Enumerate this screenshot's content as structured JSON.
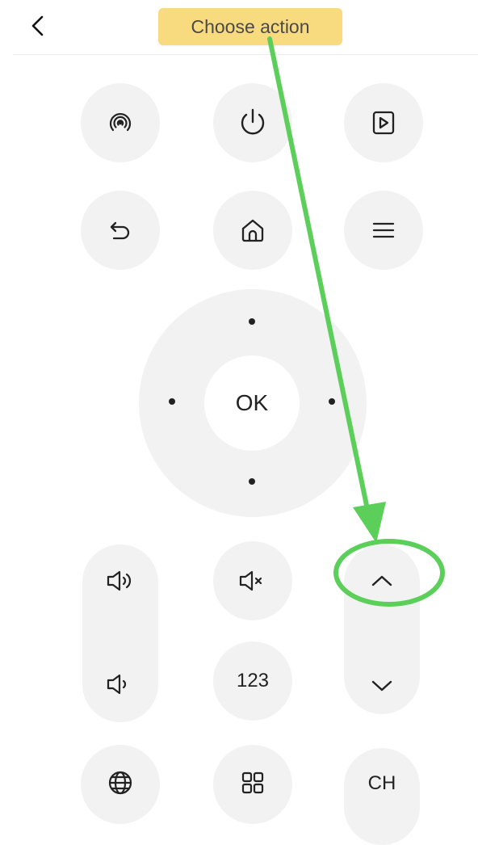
{
  "header": {
    "tooltip_text": "Choose action",
    "tooltip_color": "#f8db7e",
    "back_icon": "chevron-left-icon"
  },
  "remote": {
    "row1": [
      "cast-icon",
      "power-icon",
      "play-input-icon"
    ],
    "row2": [
      "back-icon",
      "home-icon",
      "menu-icon"
    ],
    "dpad": {
      "ok_label": "OK",
      "directions": [
        "up",
        "left",
        "right",
        "down"
      ]
    },
    "volume": {
      "up_icon": "volume-up-icon",
      "down_icon": "volume-down-icon"
    },
    "mute_icon": "mute-icon",
    "numbers_label": "123",
    "channel": {
      "up_icon": "chevron-up-icon",
      "down_icon": "chevron-down-icon",
      "label": "CH"
    },
    "row_bottom": [
      "globe-icon",
      "apps-grid-icon"
    ]
  },
  "annotation": {
    "color": "#5ccf5a",
    "target": "channel-up-button"
  }
}
